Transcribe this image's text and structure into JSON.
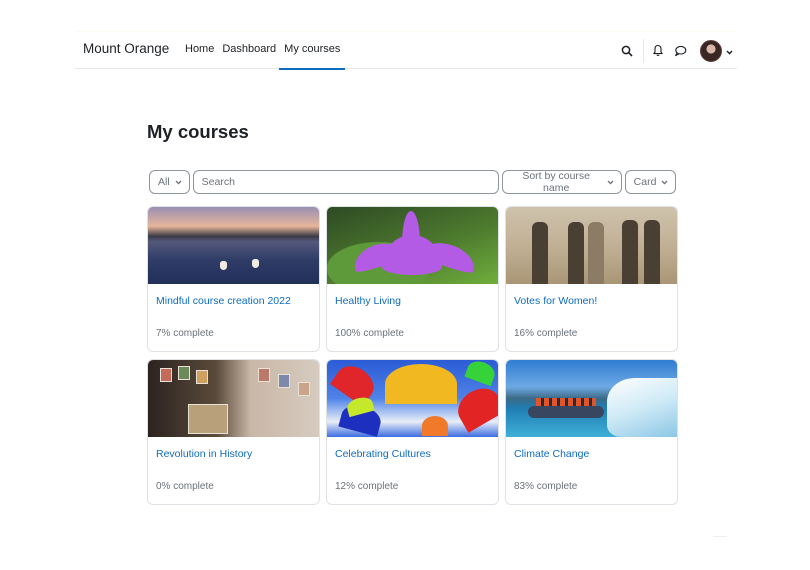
{
  "navbar": {
    "brand": "Mount Orange",
    "links": [
      {
        "label": "Home",
        "active": false
      },
      {
        "label": "Dashboard",
        "active": false
      },
      {
        "label": "My courses",
        "active": true
      }
    ],
    "icons": [
      "search-icon",
      "bell-icon",
      "message-icon"
    ],
    "user_menu": {
      "avatar": "user-avatar",
      "caret": "chevron-down-icon"
    }
  },
  "page": {
    "title": "My courses"
  },
  "filters": {
    "grouping": "All",
    "search_placeholder": "Search",
    "search_value": "",
    "sort": "Sort by course name",
    "view": "Card"
  },
  "courses": [
    {
      "title": "Mindful course creation 2022",
      "progress": "7% complete",
      "progress_value": 7
    },
    {
      "title": "Healthy Living",
      "progress": "100% complete",
      "progress_value": 100
    },
    {
      "title": "Votes for Women!",
      "progress": "16% complete",
      "progress_value": 16
    },
    {
      "title": "Revolution in History",
      "progress": "0% complete",
      "progress_value": 0
    },
    {
      "title": "Celebrating Cultures",
      "progress": "12% complete",
      "progress_value": 12
    },
    {
      "title": "Climate Change",
      "progress": "83% complete",
      "progress_value": 83
    }
  ],
  "colors": {
    "accent": "#0f6cbf",
    "text": "#1d2125",
    "muted": "#6a737b",
    "border": "#dee2e6"
  }
}
